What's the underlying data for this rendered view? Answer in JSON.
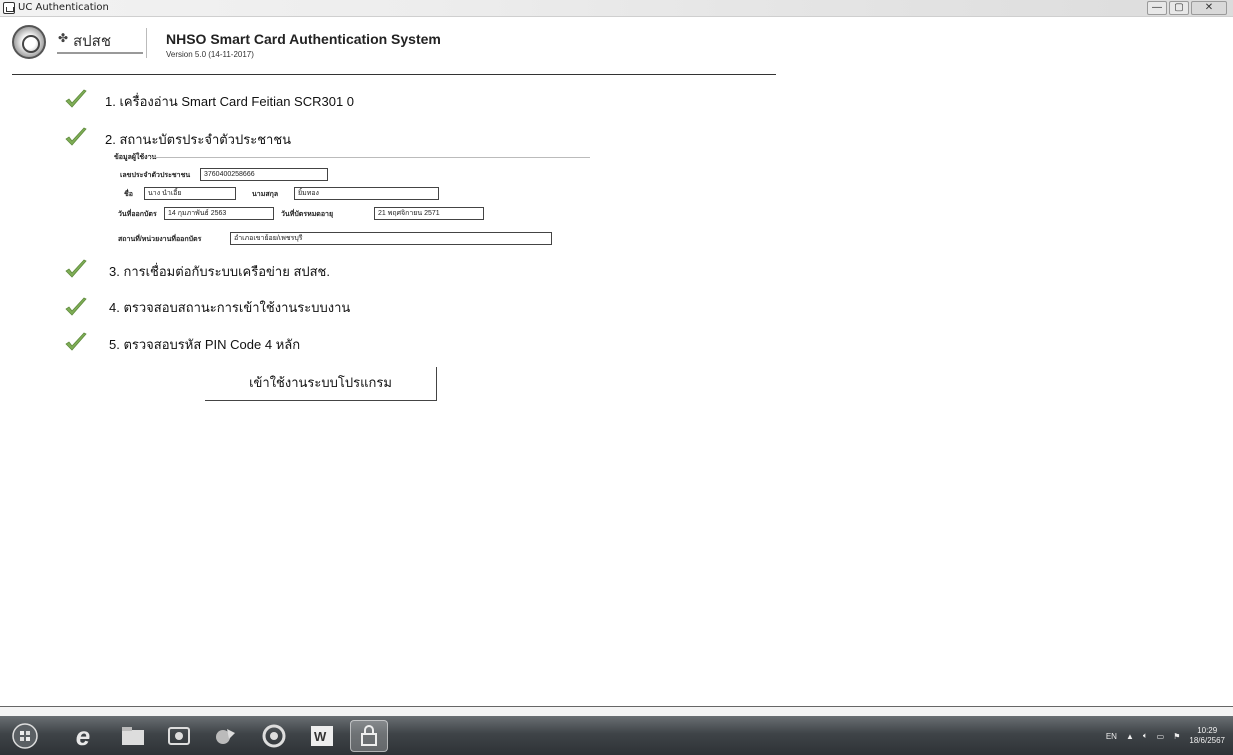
{
  "window": {
    "title": "UC Authentication",
    "min_label": "—",
    "max_label": "▢",
    "close_label": "✕"
  },
  "header": {
    "brand": "สปสช",
    "app_title": "NHSO Smart Card  Authentication System",
    "version": "Version 5.0 (14-11-2017)"
  },
  "steps": [
    {
      "label": "1. เครื่องอ่าน Smart Card  Feitian SCR301 0"
    },
    {
      "label": "2. สถานะบัตรประจำตัวประชาชน"
    },
    {
      "label": "3. การเชื่อมต่อกับระบบเครือข่าย สปสช."
    },
    {
      "label": "4. ตรวจสอบสถานะการเข้าใช้งานระบบงาน"
    },
    {
      "label": "5. ตรวจสอบรหัส PIN Code 4 หลัก"
    }
  ],
  "card_info": {
    "legend": "ข้อมูลผู้ใช้งาน",
    "citizen_id_label": "เลขประจำตัวประชาชน",
    "citizen_id": "3760400258666",
    "name_label": "ชื่อ",
    "first_name": "นาง นำเอี้ย",
    "surname_label": "นามสกุล",
    "surname": "ยิ้มทอง",
    "issue_date_label": "วันที่ออกบัตร",
    "issue_date": "14 กุมภาพันธ์ 2563",
    "expiry_date_label": "วันที่บัตรหมดอายุ",
    "expiry_date": "21 พฤศจิกายน 2571",
    "issuer_label": "สถานที่/หน่วยงานที่ออกบัตร",
    "issuer": "อำเภอเขาย้อย/เพชรบุรี"
  },
  "enter_button": {
    "label": "เข้าใช้งานระบบโปรแกรม"
  },
  "taskbar": {
    "language": "EN",
    "time": "10:29",
    "date": "18/6/2567"
  },
  "colors": {
    "check_green": "#7fae56",
    "taskbar_dark": "#3f4448"
  }
}
